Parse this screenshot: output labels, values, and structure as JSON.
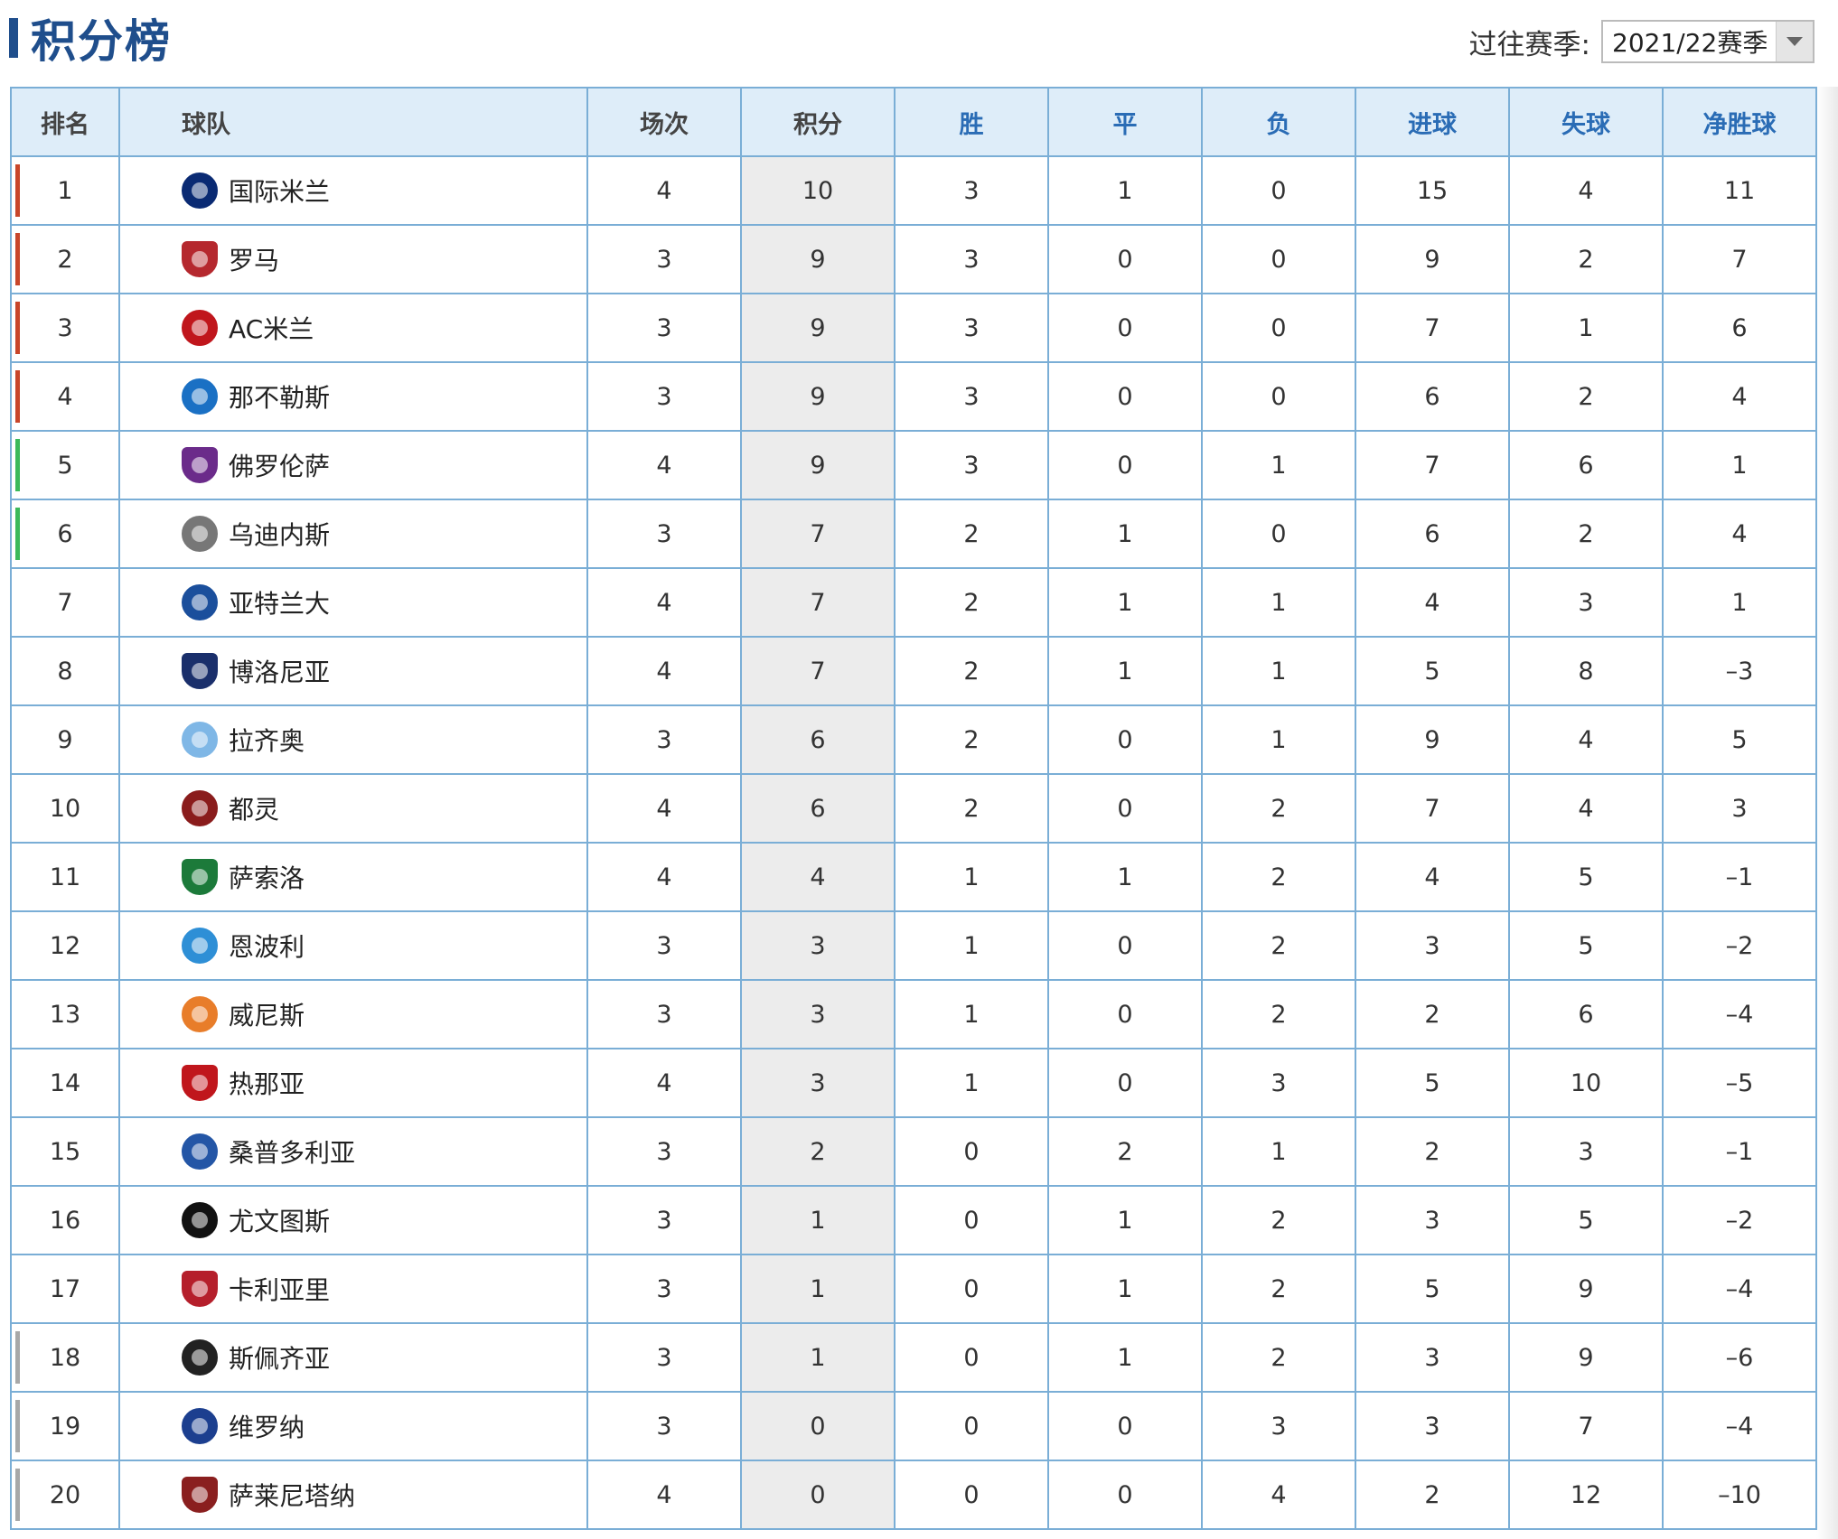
{
  "header": {
    "title": "积分榜",
    "season_label": "过往赛季:",
    "season_value": "2021/22赛季"
  },
  "columns": [
    "排名",
    "球队",
    "场次",
    "积分",
    "胜",
    "平",
    "负",
    "进球",
    "失球",
    "净胜球"
  ],
  "colors": {
    "title_blue": "#1f4e8c",
    "header_bg": "#deedf9",
    "border": "#7aaed6",
    "champions_zone": "#c8462a",
    "europa_zone": "#3cb95a",
    "relegation_zone": "#a8a8a8",
    "points_bg": "#ececec"
  },
  "rows": [
    {
      "rank": "1",
      "team": "国际米兰",
      "icon": "inter-milan-crest-icon",
      "badge_color": "#0a2a73",
      "played": "4",
      "pts": "10",
      "w": "3",
      "d": "1",
      "l": "0",
      "gf": "15",
      "ga": "4",
      "gd": "11",
      "zone": "champions"
    },
    {
      "rank": "2",
      "team": "罗马",
      "icon": "roma-crest-icon",
      "badge_color": "#b5282e",
      "played": "3",
      "pts": "9",
      "w": "3",
      "d": "0",
      "l": "0",
      "gf": "9",
      "ga": "2",
      "gd": "7",
      "zone": "champions"
    },
    {
      "rank": "3",
      "team": "AC米兰",
      "icon": "ac-milan-crest-icon",
      "badge_color": "#c0161c",
      "played": "3",
      "pts": "9",
      "w": "3",
      "d": "0",
      "l": "0",
      "gf": "7",
      "ga": "1",
      "gd": "6",
      "zone": "champions"
    },
    {
      "rank": "4",
      "team": "那不勒斯",
      "icon": "napoli-crest-icon",
      "badge_color": "#1a70c4",
      "played": "3",
      "pts": "9",
      "w": "3",
      "d": "0",
      "l": "0",
      "gf": "6",
      "ga": "2",
      "gd": "4",
      "zone": "champions"
    },
    {
      "rank": "5",
      "team": "佛罗伦萨",
      "icon": "fiorentina-crest-icon",
      "badge_color": "#6b2b8a",
      "played": "4",
      "pts": "9",
      "w": "3",
      "d": "0",
      "l": "1",
      "gf": "7",
      "ga": "6",
      "gd": "1",
      "zone": "europa"
    },
    {
      "rank": "6",
      "team": "乌迪内斯",
      "icon": "udinese-crest-icon",
      "badge_color": "#777777",
      "played": "3",
      "pts": "7",
      "w": "2",
      "d": "1",
      "l": "0",
      "gf": "6",
      "ga": "2",
      "gd": "4",
      "zone": "europa"
    },
    {
      "rank": "7",
      "team": "亚特兰大",
      "icon": "atalanta-crest-icon",
      "badge_color": "#1b4f9c",
      "played": "4",
      "pts": "7",
      "w": "2",
      "d": "1",
      "l": "1",
      "gf": "4",
      "ga": "3",
      "gd": "1",
      "zone": ""
    },
    {
      "rank": "8",
      "team": "博洛尼亚",
      "icon": "bologna-crest-icon",
      "badge_color": "#1a2f6b",
      "played": "4",
      "pts": "7",
      "w": "2",
      "d": "1",
      "l": "1",
      "gf": "5",
      "ga": "8",
      "gd": "–3",
      "zone": ""
    },
    {
      "rank": "9",
      "team": "拉齐奥",
      "icon": "lazio-crest-icon",
      "badge_color": "#7fb7e6",
      "played": "3",
      "pts": "6",
      "w": "2",
      "d": "0",
      "l": "1",
      "gf": "9",
      "ga": "4",
      "gd": "5",
      "zone": ""
    },
    {
      "rank": "10",
      "team": "都灵",
      "icon": "torino-crest-icon",
      "badge_color": "#8a1c1c",
      "played": "4",
      "pts": "6",
      "w": "2",
      "d": "0",
      "l": "2",
      "gf": "7",
      "ga": "4",
      "gd": "3",
      "zone": ""
    },
    {
      "rank": "11",
      "team": "萨索洛",
      "icon": "sassuolo-crest-icon",
      "badge_color": "#1c7a3a",
      "played": "4",
      "pts": "4",
      "w": "1",
      "d": "1",
      "l": "2",
      "gf": "4",
      "ga": "5",
      "gd": "–1",
      "zone": ""
    },
    {
      "rank": "12",
      "team": "恩波利",
      "icon": "empoli-crest-icon",
      "badge_color": "#2e8fd6",
      "played": "3",
      "pts": "3",
      "w": "1",
      "d": "0",
      "l": "2",
      "gf": "3",
      "ga": "5",
      "gd": "–2",
      "zone": ""
    },
    {
      "rank": "13",
      "team": "威尼斯",
      "icon": "venezia-crest-icon",
      "badge_color": "#e87d2a",
      "played": "3",
      "pts": "3",
      "w": "1",
      "d": "0",
      "l": "2",
      "gf": "2",
      "ga": "6",
      "gd": "–4",
      "zone": ""
    },
    {
      "rank": "14",
      "team": "热那亚",
      "icon": "genoa-crest-icon",
      "badge_color": "#c0161c",
      "played": "4",
      "pts": "3",
      "w": "1",
      "d": "0",
      "l": "3",
      "gf": "5",
      "ga": "10",
      "gd": "–5",
      "zone": ""
    },
    {
      "rank": "15",
      "team": "桑普多利亚",
      "icon": "sampdoria-crest-icon",
      "badge_color": "#2456a6",
      "played": "3",
      "pts": "2",
      "w": "0",
      "d": "2",
      "l": "1",
      "gf": "2",
      "ga": "3",
      "gd": "–1",
      "zone": ""
    },
    {
      "rank": "16",
      "team": "尤文图斯",
      "icon": "juventus-crest-icon",
      "badge_color": "#111111",
      "played": "3",
      "pts": "1",
      "w": "0",
      "d": "1",
      "l": "2",
      "gf": "3",
      "ga": "5",
      "gd": "–2",
      "zone": ""
    },
    {
      "rank": "17",
      "team": "卡利亚里",
      "icon": "cagliari-crest-icon",
      "badge_color": "#b51f2b",
      "played": "3",
      "pts": "1",
      "w": "0",
      "d": "1",
      "l": "2",
      "gf": "5",
      "ga": "9",
      "gd": "–4",
      "zone": ""
    },
    {
      "rank": "18",
      "team": "斯佩齐亚",
      "icon": "spezia-crest-icon",
      "badge_color": "#222222",
      "played": "3",
      "pts": "1",
      "w": "0",
      "d": "1",
      "l": "2",
      "gf": "3",
      "ga": "9",
      "gd": "–6",
      "zone": "relegation"
    },
    {
      "rank": "19",
      "team": "维罗纳",
      "icon": "verona-crest-icon",
      "badge_color": "#1c3f8f",
      "played": "3",
      "pts": "0",
      "w": "0",
      "d": "0",
      "l": "3",
      "gf": "3",
      "ga": "7",
      "gd": "–4",
      "zone": "relegation"
    },
    {
      "rank": "20",
      "team": "萨莱尼塔纳",
      "icon": "salernitana-crest-icon",
      "badge_color": "#8a1f1f",
      "played": "4",
      "pts": "0",
      "w": "0",
      "d": "0",
      "l": "4",
      "gf": "2",
      "ga": "12",
      "gd": "–10",
      "zone": "relegation"
    }
  ]
}
